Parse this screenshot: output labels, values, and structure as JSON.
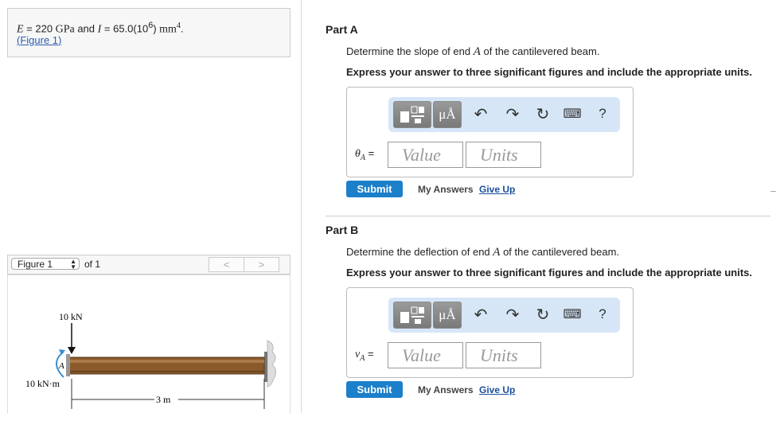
{
  "given": {
    "e_symbol": "E",
    "e_eq": " = 220",
    "e_unit": " GPa",
    "and": " and ",
    "i_symbol": "I",
    "i_eq": " = 65.0(10",
    "i_exp": "6",
    "i_close": ")",
    "i_unit": " mm",
    "i_unit_exp": "4",
    "period": ".",
    "figure_link_open": "(",
    "figure_link": "Figure 1",
    "figure_link_close": ")"
  },
  "figure_nav": {
    "selected": "Figure 1",
    "of_label": "of 1",
    "prev": "<",
    "next": ">"
  },
  "figure": {
    "load_label": "10 kN",
    "moment_label": "10 kN·m",
    "point_label": "A",
    "length_label": "3 m"
  },
  "parts": [
    {
      "title": "Part A",
      "question_pre": "Determine the slope of end ",
      "question_var": "A",
      "question_post": " of the cantilevered beam.",
      "instruction": "Express your answer to three significant figures and include the appropriate units.",
      "var_symbol": "θ",
      "var_sub": "A",
      "var_eq": " =",
      "value_placeholder": "Value",
      "units_placeholder": "Units",
      "submit": "Submit",
      "my_answers": "My Answers",
      "give_up": "Give Up"
    },
    {
      "title": "Part B",
      "question_pre": "Determine the deflection of end ",
      "question_var": "A",
      "question_post": " of the cantilevered beam.",
      "instruction": "Express your answer to three significant figures and include the appropriate units.",
      "var_symbol": "v",
      "var_sub": "A",
      "var_eq": " =",
      "value_placeholder": "Value",
      "units_placeholder": "Units",
      "submit": "Submit",
      "my_answers": "My Answers",
      "give_up": "Give Up"
    }
  ],
  "toolbar": {
    "templates_icon": "templates-icon",
    "units_button": "μÅ",
    "undo_icon": "undo-icon",
    "redo_icon": "redo-icon",
    "reset_icon": "reset-icon",
    "keyboard_icon": "keyboard-icon",
    "help": "?"
  }
}
